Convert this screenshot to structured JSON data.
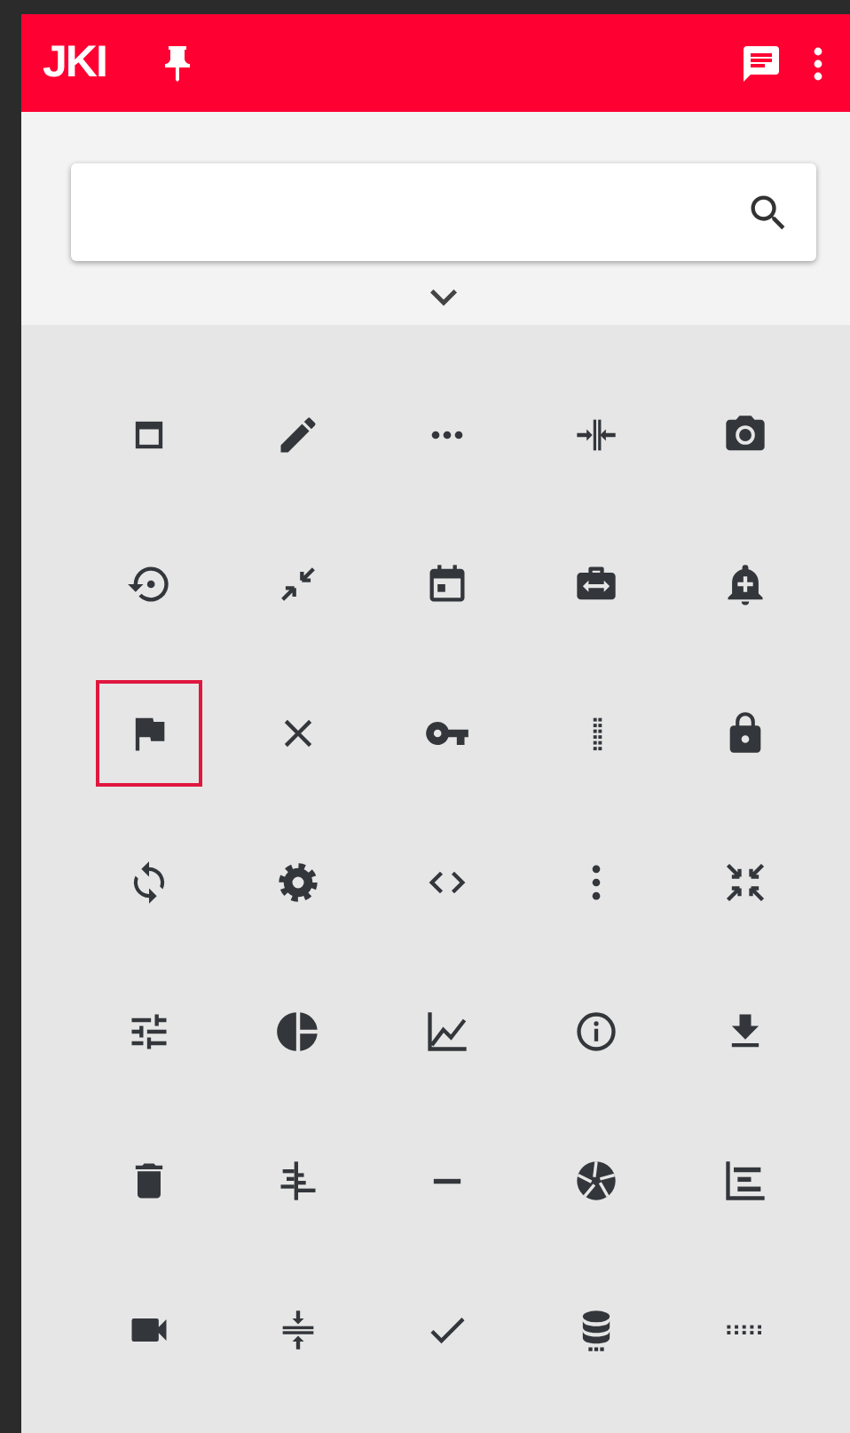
{
  "header": {
    "logo": "JKI"
  },
  "icons": [
    {
      "kind": "window",
      "selected": false
    },
    {
      "kind": "pencil",
      "selected": false
    },
    {
      "kind": "dots-horizontal",
      "selected": false
    },
    {
      "kind": "arrows-to-bar",
      "selected": false
    },
    {
      "kind": "camera",
      "selected": false
    },
    {
      "kind": "restore",
      "selected": false
    },
    {
      "kind": "shrink",
      "selected": false
    },
    {
      "kind": "calendar",
      "selected": false
    },
    {
      "kind": "case-arrows",
      "selected": false
    },
    {
      "kind": "bell-plus",
      "selected": false
    },
    {
      "kind": "flag",
      "selected": true
    },
    {
      "kind": "close",
      "selected": false
    },
    {
      "kind": "key",
      "selected": false
    },
    {
      "kind": "drag-vertical",
      "selected": false
    },
    {
      "kind": "lock",
      "selected": false
    },
    {
      "kind": "sync",
      "selected": false
    },
    {
      "kind": "gear",
      "selected": false
    },
    {
      "kind": "code",
      "selected": false
    },
    {
      "kind": "dots-vertical",
      "selected": false
    },
    {
      "kind": "collapse-all",
      "selected": false
    },
    {
      "kind": "sliders",
      "selected": false
    },
    {
      "kind": "pie-chart",
      "selected": false
    },
    {
      "kind": "line-chart",
      "selected": false
    },
    {
      "kind": "info",
      "selected": false
    },
    {
      "kind": "download",
      "selected": false
    },
    {
      "kind": "trash",
      "selected": false
    },
    {
      "kind": "align-center",
      "selected": false
    },
    {
      "kind": "minus",
      "selected": false
    },
    {
      "kind": "aperture",
      "selected": false
    },
    {
      "kind": "bar-chart",
      "selected": false
    },
    {
      "kind": "video",
      "selected": false
    },
    {
      "kind": "compress-vertical",
      "selected": false
    },
    {
      "kind": "check",
      "selected": false
    },
    {
      "kind": "database",
      "selected": false
    },
    {
      "kind": "drag-horizontal",
      "selected": false
    }
  ]
}
